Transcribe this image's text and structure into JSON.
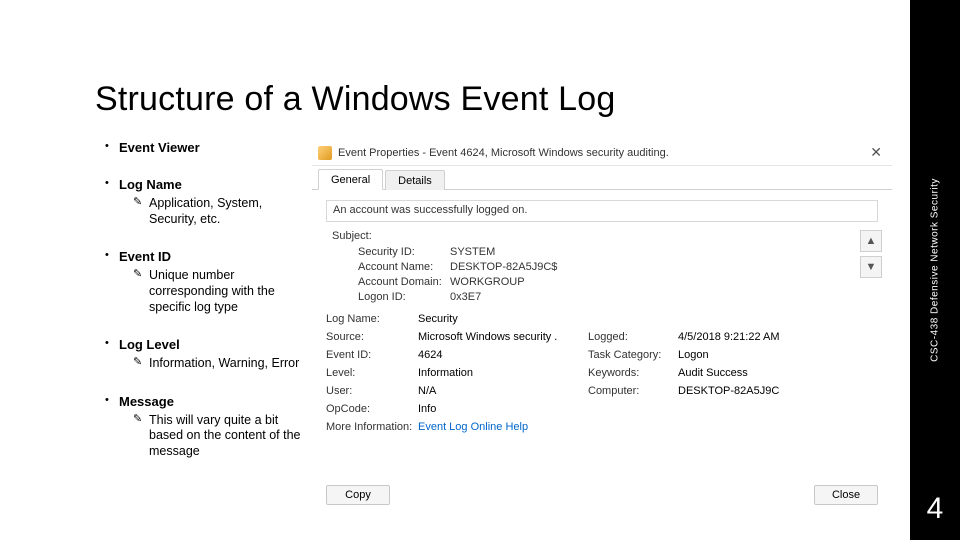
{
  "title": "Structure of a Windows Event Log",
  "bullets": [
    {
      "head": "Event Viewer",
      "subs": []
    },
    {
      "head": "Log Name",
      "subs": [
        "Application, System, Security, etc."
      ]
    },
    {
      "head": "Event ID",
      "subs": [
        "Unique number corresponding with the specific log type"
      ]
    },
    {
      "head": "Log Level",
      "subs": [
        "Information, Warning, Error"
      ]
    },
    {
      "head": "Message",
      "subs": [
        "This will vary quite a bit based on the content of the message"
      ]
    }
  ],
  "side": {
    "course": "CSC-438 Defensive Network Security",
    "page": "4"
  },
  "win": {
    "title": "Event Properties - Event 4624, Microsoft Windows security auditing.",
    "close": "✕",
    "tabs": {
      "general": "General",
      "details": "Details"
    },
    "msg": "An account was successfully logged on.",
    "subject_label": "Subject:",
    "subject": {
      "k1": "Security ID:",
      "v1": "SYSTEM",
      "k2": "Account Name:",
      "v2": "DESKTOP-82A5J9C$",
      "k3": "Account Domain:",
      "v3": "WORKGROUP",
      "k4": "Logon ID:",
      "v4": "0x3E7"
    },
    "details": {
      "k_logname": "Log Name:",
      "v_logname": "Security",
      "k_source": "Source:",
      "v_source": "Microsoft Windows security .",
      "k_logged": "Logged:",
      "v_logged": "4/5/2018 9:21:22 AM",
      "k_eventid": "Event ID:",
      "v_eventid": "4624",
      "k_taskcat": "Task Category:",
      "v_taskcat": "Logon",
      "k_level": "Level:",
      "v_level": "Information",
      "k_keywords": "Keywords:",
      "v_keywords": "Audit Success",
      "k_user": "User:",
      "v_user": "N/A",
      "k_computer": "Computer:",
      "v_computer": "DESKTOP-82A5J9C",
      "k_opcode": "OpCode:",
      "v_opcode": "Info",
      "k_moreinfo": "More Information:",
      "v_moreinfo": "Event Log Online Help"
    },
    "buttons": {
      "copy": "Copy",
      "close": "Close"
    },
    "arrows": {
      "up": "▲",
      "down": "▼"
    }
  }
}
